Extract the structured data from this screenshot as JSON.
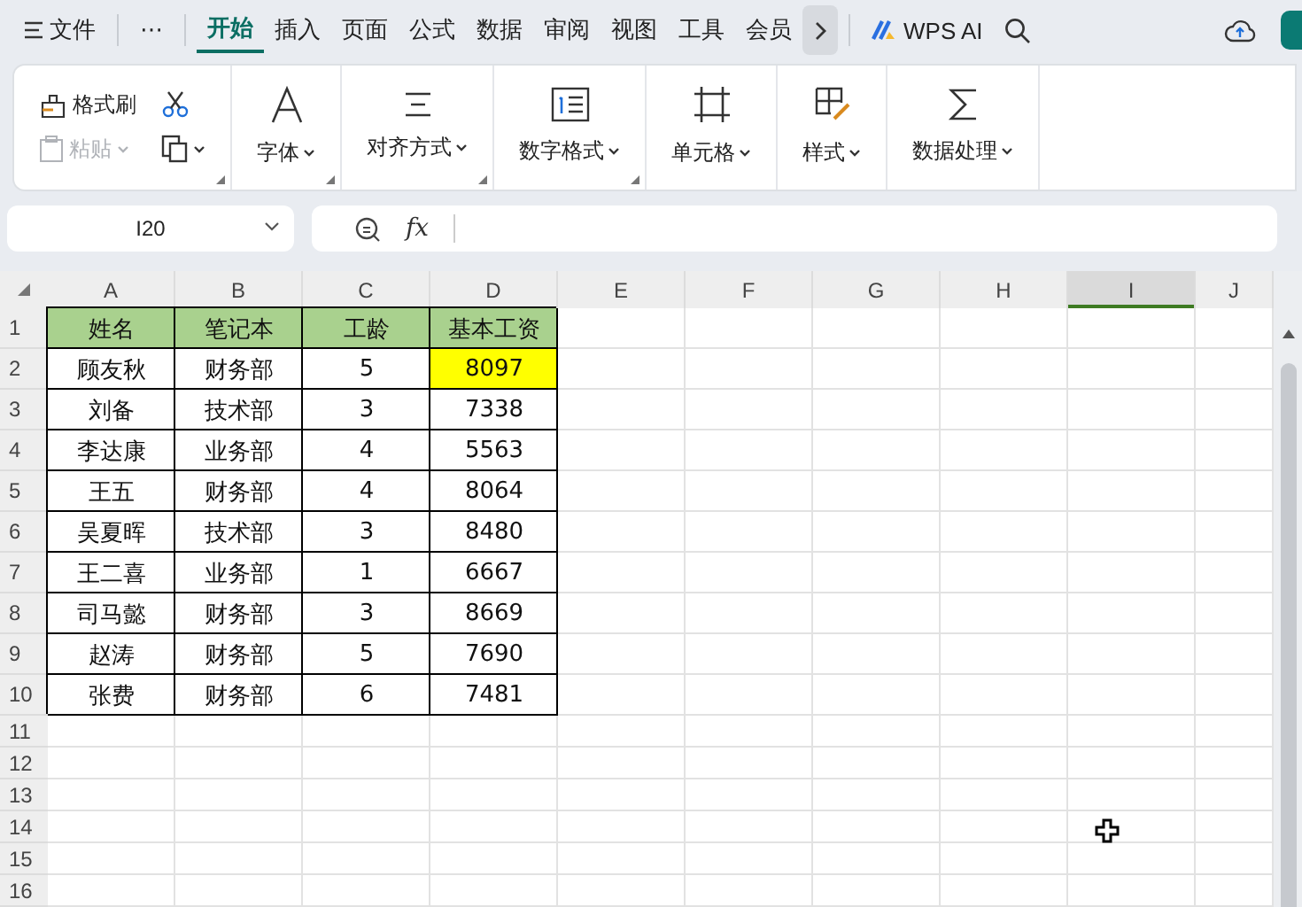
{
  "menu_bar": {
    "file_menu": "文件",
    "more": "⋯",
    "tabs": [
      {
        "label": "开始",
        "selected": true
      },
      {
        "label": "插入",
        "selected": false
      },
      {
        "label": "页面",
        "selected": false
      },
      {
        "label": "公式",
        "selected": false
      },
      {
        "label": "数据",
        "selected": false
      },
      {
        "label": "审阅",
        "selected": false
      },
      {
        "label": "视图",
        "selected": false
      },
      {
        "label": "工具",
        "selected": false
      },
      {
        "label": "会员",
        "selected": false
      }
    ],
    "ai_button": "WPS AI"
  },
  "ribbon": {
    "format_painter": "格式刷",
    "paste": {
      "label": "粘贴",
      "disabled": true
    },
    "groups": [
      {
        "kind": "font",
        "label": "字体",
        "expander": true
      },
      {
        "kind": "align",
        "label": "对齐方式",
        "expander": true
      },
      {
        "kind": "number",
        "label": "数字格式",
        "expander": true
      },
      {
        "kind": "cell",
        "label": "单元格",
        "expander": false
      },
      {
        "kind": "style",
        "label": "样式",
        "expander": false
      },
      {
        "kind": "data",
        "label": "数据处理",
        "expander": false
      }
    ]
  },
  "name_box": "I20",
  "formula_bar": {
    "fx": "fx"
  },
  "sheet": {
    "columns": [
      {
        "label": "A",
        "selected": false
      },
      {
        "label": "B",
        "selected": false
      },
      {
        "label": "C",
        "selected": false
      },
      {
        "label": "D",
        "selected": false
      },
      {
        "label": "E",
        "selected": false
      },
      {
        "label": "F",
        "selected": false
      },
      {
        "label": "G",
        "selected": false
      },
      {
        "label": "H",
        "selected": false
      },
      {
        "label": "I",
        "selected": true
      },
      {
        "label": "J",
        "selected": false
      }
    ],
    "row_numbers": [
      "1",
      "2",
      "3",
      "4",
      "5",
      "6",
      "7",
      "8",
      "9",
      "10",
      "11",
      "12",
      "13",
      "14",
      "15",
      "16"
    ],
    "rows": [
      {
        "kind": "header",
        "cells": [
          {
            "text": "姓名",
            "highlighted": false
          },
          {
            "text": "笔记本",
            "highlighted": false
          },
          {
            "text": "工龄",
            "highlighted": false
          },
          {
            "text": "基本工资",
            "highlighted": false
          }
        ]
      },
      {
        "kind": "data",
        "cells": [
          {
            "text": "顾友秋",
            "highlighted": false
          },
          {
            "text": "财务部",
            "highlighted": false
          },
          {
            "text": "5",
            "highlighted": false
          },
          {
            "text": "8097",
            "highlighted": true
          }
        ]
      },
      {
        "kind": "data",
        "cells": [
          {
            "text": "刘备",
            "highlighted": false
          },
          {
            "text": "技术部",
            "highlighted": false
          },
          {
            "text": "3",
            "highlighted": false
          },
          {
            "text": "7338",
            "highlighted": false
          }
        ]
      },
      {
        "kind": "data",
        "cells": [
          {
            "text": "李达康",
            "highlighted": false
          },
          {
            "text": "业务部",
            "highlighted": false
          },
          {
            "text": "4",
            "highlighted": false
          },
          {
            "text": "5563",
            "highlighted": false
          }
        ]
      },
      {
        "kind": "data",
        "cells": [
          {
            "text": "王五",
            "highlighted": false
          },
          {
            "text": "财务部",
            "highlighted": false
          },
          {
            "text": "4",
            "highlighted": false
          },
          {
            "text": "8064",
            "highlighted": false
          }
        ]
      },
      {
        "kind": "data",
        "cells": [
          {
            "text": "吴夏晖",
            "highlighted": false
          },
          {
            "text": "技术部",
            "highlighted": false
          },
          {
            "text": "3",
            "highlighted": false
          },
          {
            "text": "8480",
            "highlighted": false
          }
        ]
      },
      {
        "kind": "data",
        "cells": [
          {
            "text": "王二喜",
            "highlighted": false
          },
          {
            "text": "业务部",
            "highlighted": false
          },
          {
            "text": "1",
            "highlighted": false
          },
          {
            "text": "6667",
            "highlighted": false
          }
        ]
      },
      {
        "kind": "data",
        "cells": [
          {
            "text": "司马懿",
            "highlighted": false
          },
          {
            "text": "财务部",
            "highlighted": false
          },
          {
            "text": "3",
            "highlighted": false
          },
          {
            "text": "8669",
            "highlighted": false
          }
        ]
      },
      {
        "kind": "data",
        "cells": [
          {
            "text": "赵涛",
            "highlighted": false
          },
          {
            "text": "财务部",
            "highlighted": false
          },
          {
            "text": "5",
            "highlighted": false
          },
          {
            "text": "7690",
            "highlighted": false
          }
        ]
      },
      {
        "kind": "data",
        "cells": [
          {
            "text": "张费",
            "highlighted": false
          },
          {
            "text": "财务部",
            "highlighted": false
          },
          {
            "text": "6",
            "highlighted": false
          },
          {
            "text": "7481",
            "highlighted": false
          }
        ]
      }
    ]
  }
}
